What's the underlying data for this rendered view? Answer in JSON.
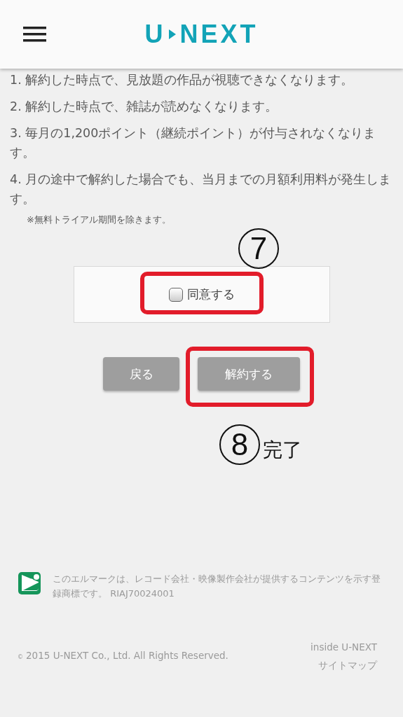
{
  "header": {
    "logo_left": "U",
    "logo_right": "NEXT"
  },
  "notices": [
    {
      "text": "1. 解約した時点で、見放題の作品が視聴できなくなります。"
    },
    {
      "text": "2. 解約した時点で、雑誌が読めなくなります。"
    },
    {
      "text": "3. 毎月の1,200ポイント（継続ポイント）が付与されなくなります。"
    },
    {
      "text": "4. 月の途中で解約した場合でも、当月までの月額利用料が発生します。"
    }
  ],
  "note": "※無料トライアル期間を除きます。",
  "agree": {
    "label": "同意する",
    "checked": false
  },
  "buttons": [
    {
      "label": "戻る"
    },
    {
      "label": "解約する"
    }
  ],
  "annotations": [
    {
      "number": "7"
    },
    {
      "number": "8",
      "label": "完了"
    }
  ],
  "footer": {
    "mark_text": "このエルマークは、レコード会社・映像製作会社が提供するコンテンツを示す登録商標です。 RIAJ70024001",
    "copyright_symbol": "©",
    "copyright": "2015 U-NEXT Co., Ltd. All Rights Reserved.",
    "links": [
      "inside U-NEXT",
      "サイトマップ"
    ]
  }
}
